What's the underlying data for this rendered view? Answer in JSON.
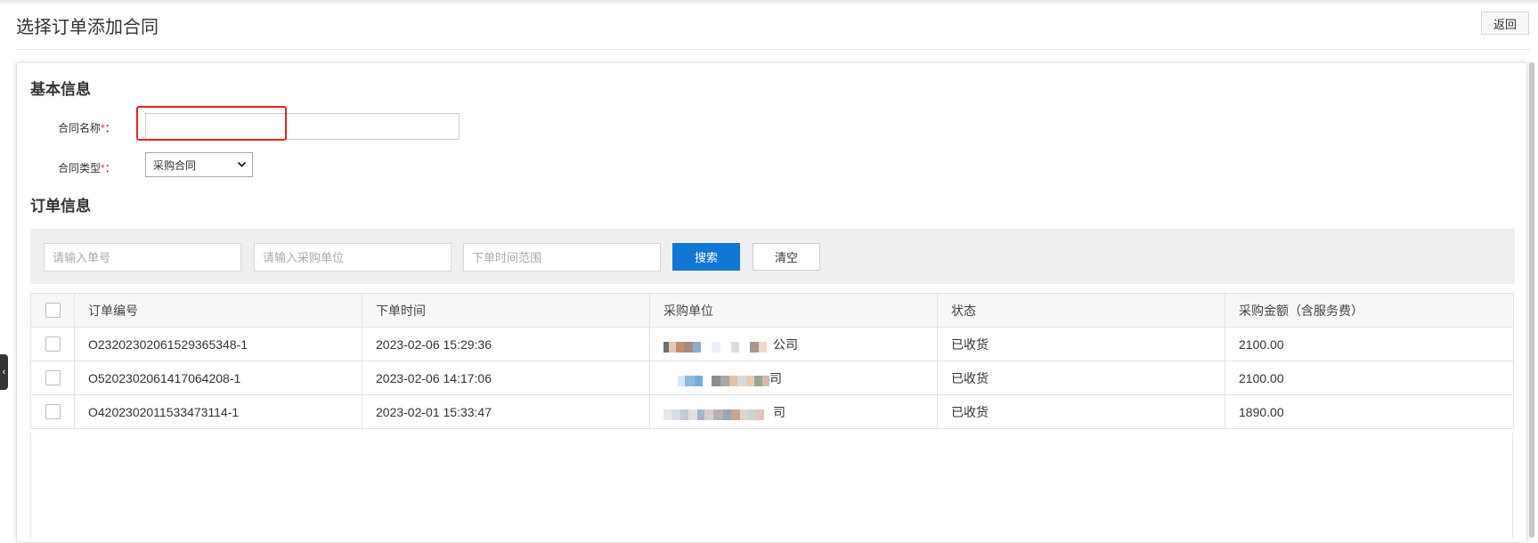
{
  "header": {
    "title": "选择订单添加合同",
    "back_label": "返回"
  },
  "basic_info": {
    "section_title": "基本信息",
    "contract_name": {
      "label": "合同名称",
      "required_mark": "*",
      "colon": "：",
      "value": "",
      "placeholder": ""
    },
    "contract_type": {
      "label": "合同类型",
      "required_mark": "*",
      "colon": "：",
      "selected": "采购合同"
    }
  },
  "order_info": {
    "section_title": "订单信息",
    "filters": {
      "order_no_placeholder": "请输入单号",
      "unit_placeholder": "请输入采购单位",
      "date_placeholder": "下单时间范围",
      "search_label": "搜索",
      "clear_label": "清空"
    },
    "table": {
      "columns": [
        "订单编号",
        "下单时间",
        "采购单位",
        "状态",
        "采购金额（含服务费）"
      ],
      "rows": [
        {
          "order_no": "O23202302061529365348-1",
          "time": "2023-02-06 15:29:36",
          "unit_suffix": "公司",
          "status": "已收货",
          "amount": "2100.00"
        },
        {
          "order_no": "O52023020614170642​08-1",
          "time": "2023-02-06 14:17:06",
          "unit_suffix": "司",
          "status": "已收货",
          "amount": "2100.00"
        },
        {
          "order_no": "O42023020115334731​14-1",
          "time": "2023-02-01 15:33:47",
          "unit_suffix": "司",
          "status": "已收货",
          "amount": "1890.00"
        }
      ]
    }
  },
  "colors": {
    "primary": "#1277d4",
    "highlight": "#e8211d",
    "required": "#e4393c"
  },
  "icons": {
    "side_toggle": "‹",
    "select_chevron": "⌄"
  }
}
